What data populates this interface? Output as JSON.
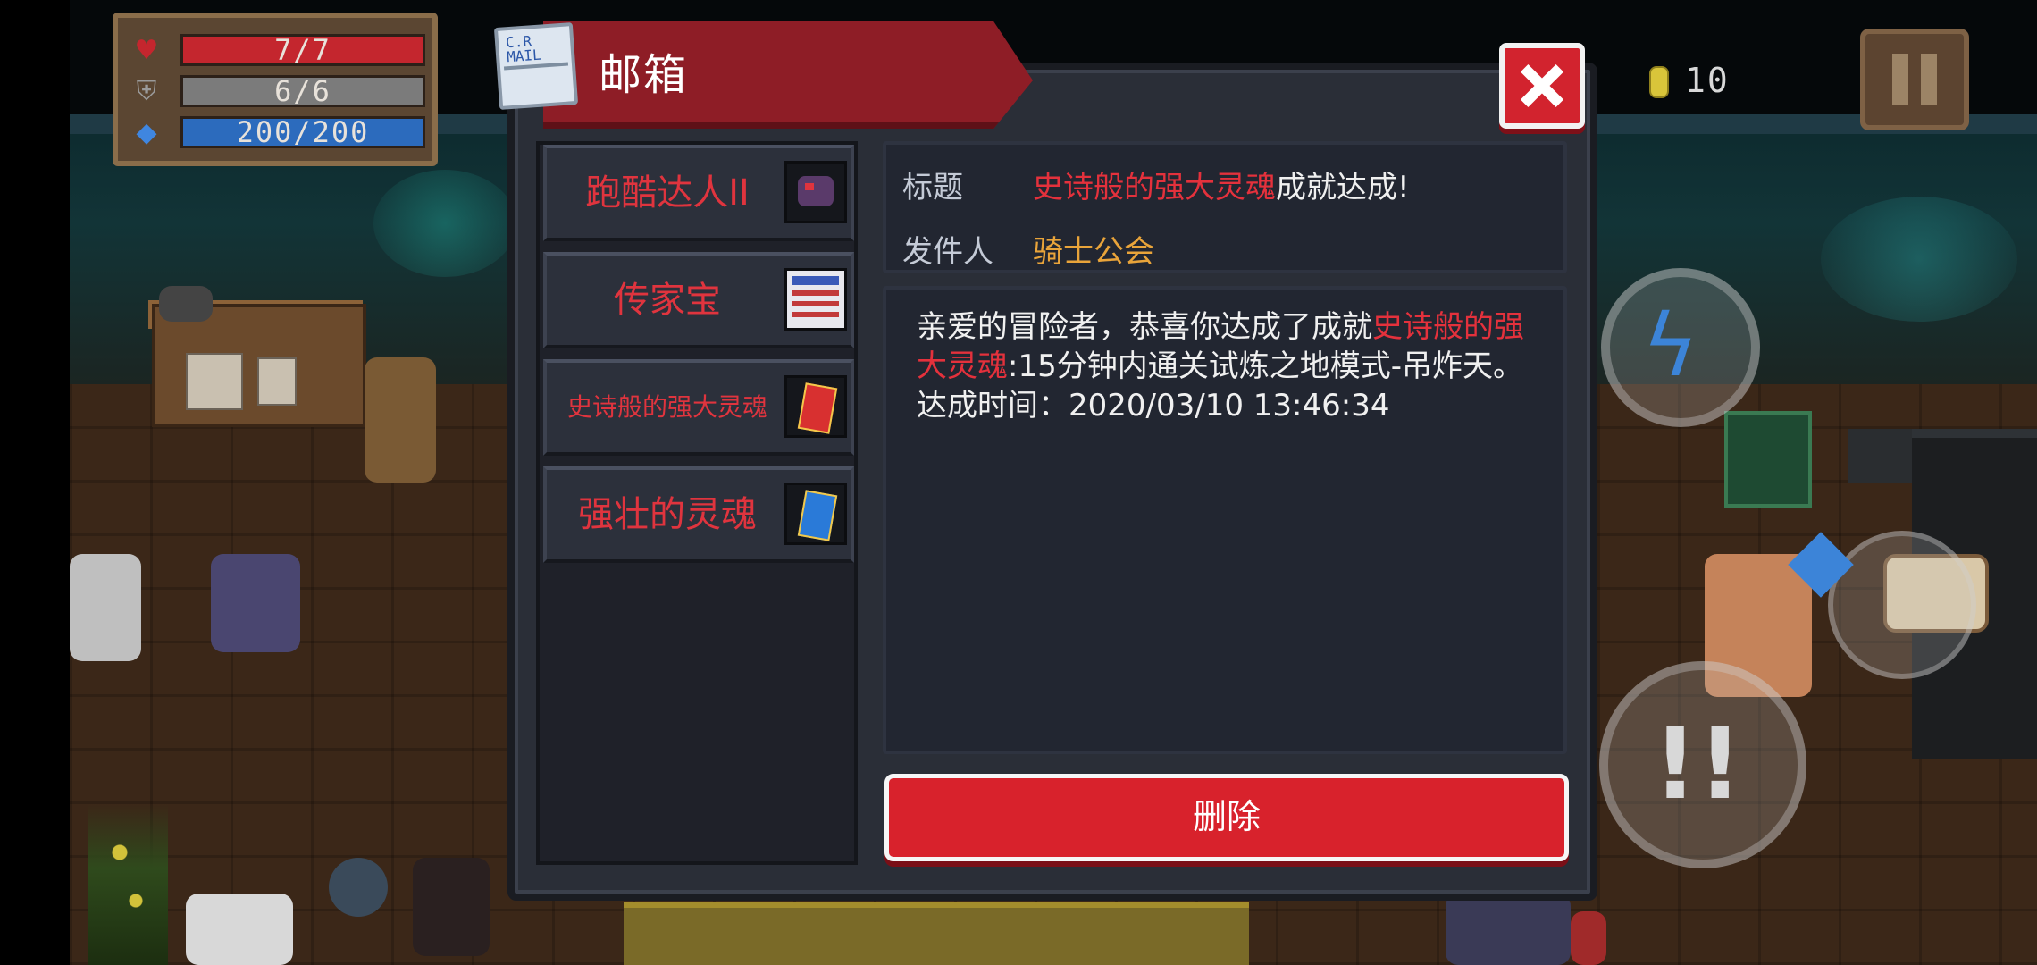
{
  "hud": {
    "hp": "7/7",
    "armor": "6/6",
    "energy": "200/200",
    "coins": "10",
    "hp_icon": "heart-icon",
    "armor_icon": "shield-icon",
    "energy_icon": "diamond-icon"
  },
  "dialog": {
    "title": "邮箱",
    "icon_text_1": "C.R",
    "icon_text_2": "MAIL"
  },
  "mail_list": [
    {
      "label": "跑酷达人II"
    },
    {
      "label": "传家宝"
    },
    {
      "label": "史诗般的强大灵魂"
    },
    {
      "label": "强壮的灵魂"
    }
  ],
  "mail_detail": {
    "title_label": "标题",
    "title_highlight": "史诗般的强大灵魂",
    "title_rest": "成就达成!",
    "sender_label": "发件人",
    "sender": "骑士公会",
    "body_prefix": "亲爱的冒险者，恭喜你达成了成就",
    "body_highlight": "史诗般的强大灵魂",
    "body_rest": ":15分钟内通关试炼之地模式-吊炸天。",
    "time_line": "达成时间：2020/03/10 13:46:34"
  },
  "buttons": {
    "delete": "删除"
  },
  "colors": {
    "accent_red": "#d8222c",
    "highlight_red": "#e4313c",
    "sender_gold": "#e9a43a",
    "panel_bg": "#2a2e37"
  }
}
